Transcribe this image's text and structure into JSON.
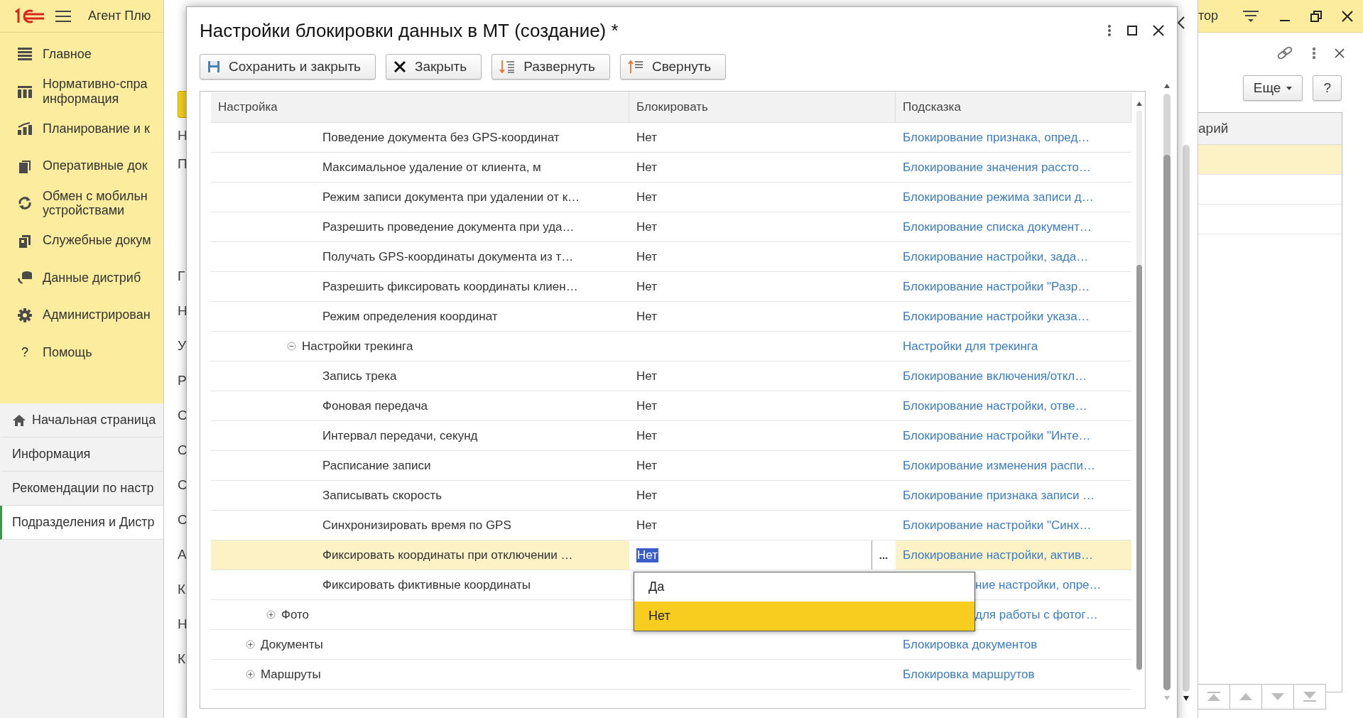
{
  "top_bar": {
    "app_name": "Агент Плю",
    "right_text": "тор"
  },
  "sidebar": {
    "sections": [
      {
        "label": "Главное"
      },
      {
        "label": "Нормативно-спра\nинформация"
      },
      {
        "label": "Планирование и к"
      },
      {
        "label": "Оперативные док"
      },
      {
        "label": "Обмен с мобильн\nустройствами"
      },
      {
        "label": "Служебные докум"
      },
      {
        "label": "Данные дистриб"
      },
      {
        "label": "Администрирован"
      },
      {
        "label": "Помощь",
        "icon_text": "?"
      }
    ],
    "nav_items": [
      {
        "label": "Начальная страница",
        "kind": "home",
        "selected": false
      },
      {
        "label": "Информация",
        "kind": "page",
        "selected": false
      },
      {
        "label": "Рекомендации по настр",
        "kind": "page",
        "selected": false
      },
      {
        "label": "Подразделения и Дистр",
        "kind": "page",
        "selected": true
      }
    ]
  },
  "background_form": {
    "letters": [
      "Н",
      "П",
      "Г",
      "Н",
      "У",
      "Р",
      "С",
      "С",
      "С",
      "С",
      "А",
      "К",
      "Н",
      "К"
    ]
  },
  "right_panel": {
    "more_button": "Еще",
    "help_button": "?",
    "column_header": "арий",
    "rows": [
      {
        "selected": true
      },
      {
        "selected": false
      },
      {
        "selected": false
      }
    ]
  },
  "dialog": {
    "title": "Настройки блокировки данных в МТ (создание) *",
    "buttons": [
      {
        "label": "Сохранить и закрыть",
        "kind": "save"
      },
      {
        "label": "Закрыть",
        "kind": "close"
      },
      {
        "label": "Развернуть",
        "kind": "expand"
      },
      {
        "label": "Свернуть",
        "kind": "collapse"
      }
    ],
    "columns": [
      "Настройка",
      "Блокировать",
      "Подсказка"
    ],
    "tree": [
      {
        "children": [
          {
            "children": [
              {
                "children": [
                  {
                    "label": "Поведение документа без GPS-координат",
                    "value": "Нет",
                    "hint": "Блокирование признака, опред…",
                    "selected": false
                  },
                  {
                    "label": "Максимальное удаление от клиента, м",
                    "value": "Нет",
                    "hint": "Блокирование значения рассто…",
                    "selected": false
                  },
                  {
                    "label": "Режим записи документа при удалении от к…",
                    "value": "Нет",
                    "hint": "Блокирование режима записи д…",
                    "selected": false
                  },
                  {
                    "label": "Разрешить проведение документа при уда…",
                    "value": "Нет",
                    "hint": "Блокирование списка документ…",
                    "selected": false
                  },
                  {
                    "label": "Получать GPS-координаты документа из т…",
                    "value": "Нет",
                    "hint": "Блокирование настройки, зада…",
                    "selected": false
                  },
                  {
                    "label": "Разрешить фиксировать координаты клиен…",
                    "value": "Нет",
                    "hint": "Блокирование настройки \"Разр…",
                    "selected": false
                  },
                  {
                    "label": "Режим определения координат",
                    "value": "Нет",
                    "hint": "Блокирование настройки указа…",
                    "selected": false
                  }
                ]
              },
              {
                "label": "Настройки трекинга",
                "hint": "Настройки для трекинга",
                "expanded": true,
                "selected": false,
                "children": [
                  {
                    "label": "Запись трека",
                    "value": "Нет",
                    "hint": "Блокирование включения/откл…",
                    "selected": false
                  },
                  {
                    "label": "Фоновая передача",
                    "value": "Нет",
                    "hint": "Блокирование настройки, отве…",
                    "selected": false
                  },
                  {
                    "label": "Интервал передачи, секунд",
                    "value": "Нет",
                    "hint": "Блокирование настройки \"Инте…",
                    "selected": false
                  },
                  {
                    "label": "Расписание записи",
                    "value": "Нет",
                    "hint": "Блокирование изменения распи…",
                    "selected": false
                  },
                  {
                    "label": "Записывать скорость",
                    "value": "Нет",
                    "hint": "Блокирование признака записи …",
                    "selected": false
                  },
                  {
                    "label": "Синхронизировать время по GPS",
                    "value": "Нет",
                    "hint": "Блокирование настройки \"Синх…",
                    "selected": false
                  },
                  {
                    "label": "Фиксировать координаты при отключении …",
                    "value": "Нет",
                    "hint": "Блокирование настройки, актив…",
                    "selected": true,
                    "edit_button": "..."
                  },
                  {
                    "label": "Фиксировать фиктивные координаты",
                    "hint": "ние настройки, опре…",
                    "covered": true,
                    "selected": false
                  }
                ]
              }
            ]
          },
          {
            "label": "Фото",
            "hint": "для работы с фотог…",
            "covered": true,
            "expanded": false,
            "selected": false
          }
        ]
      },
      {
        "label": "Документы",
        "hint": "Блокировка документов",
        "expanded": false,
        "selected": false
      },
      {
        "label": "Маршруты",
        "hint": "Блокировка маршрутов",
        "expanded": false,
        "selected": false
      }
    ],
    "dropdown": {
      "options": [
        {
          "label": "Да",
          "selected": false
        },
        {
          "label": "Нет",
          "selected": true
        }
      ]
    }
  }
}
